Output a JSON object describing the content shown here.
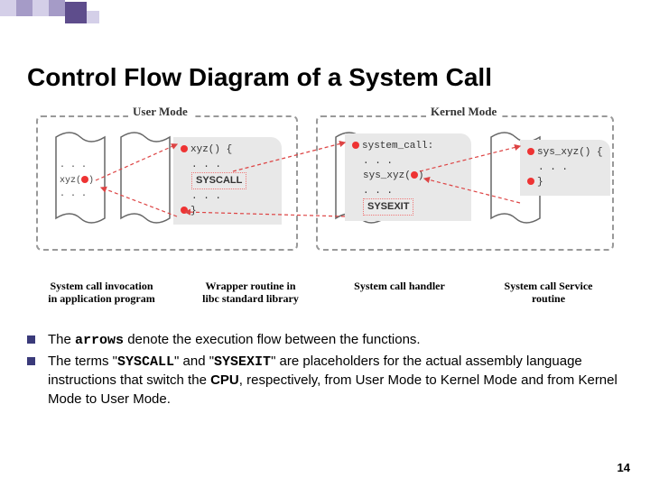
{
  "title": "Control Flow Diagram of a System Call",
  "modes": {
    "user": "User Mode",
    "kernel": "Kernel Mode"
  },
  "code": {
    "app_ellipsis": ". . .",
    "app_call": "xyz(",
    "app_close": ")",
    "wrapper_head": "xyz() {",
    "wrapper_ellipsis": ". . .",
    "wrapper_syscall": "SYSCALL",
    "wrapper_ellipsis2": ". . .",
    "wrapper_end": "}",
    "handler_head": "system_call:",
    "handler_ellipsis": ". . .",
    "handler_call": "sys_xyz(",
    "handler_close": ")",
    "handler_ellipsis2": ". . .",
    "handler_sysexit": "SYSEXIT",
    "service_head": "sys_xyz() {",
    "service_ellipsis": ". . .",
    "service_end": "}"
  },
  "captions": {
    "c1": "System call invocation in application program",
    "c2": "Wrapper routine in libc standard library",
    "c3": "System call handler",
    "c4": "System call Service routine"
  },
  "bullets": {
    "b1_pre": "The ",
    "b1_mono": "arrows",
    "b1_post": " denote the execution flow between the functions.",
    "b2_a": "The terms \"",
    "b2_mono1": "SYSCALL",
    "b2_b": "\" and \"",
    "b2_mono2": "SYSEXIT",
    "b2_c": "\" are placeholders for the actual assembly language instructions that switch the ",
    "b2_bold": "CPU",
    "b2_d": ", respectively, from User Mode to Kernel Mode and from Kernel Mode to User Mode."
  },
  "page_number": "14"
}
